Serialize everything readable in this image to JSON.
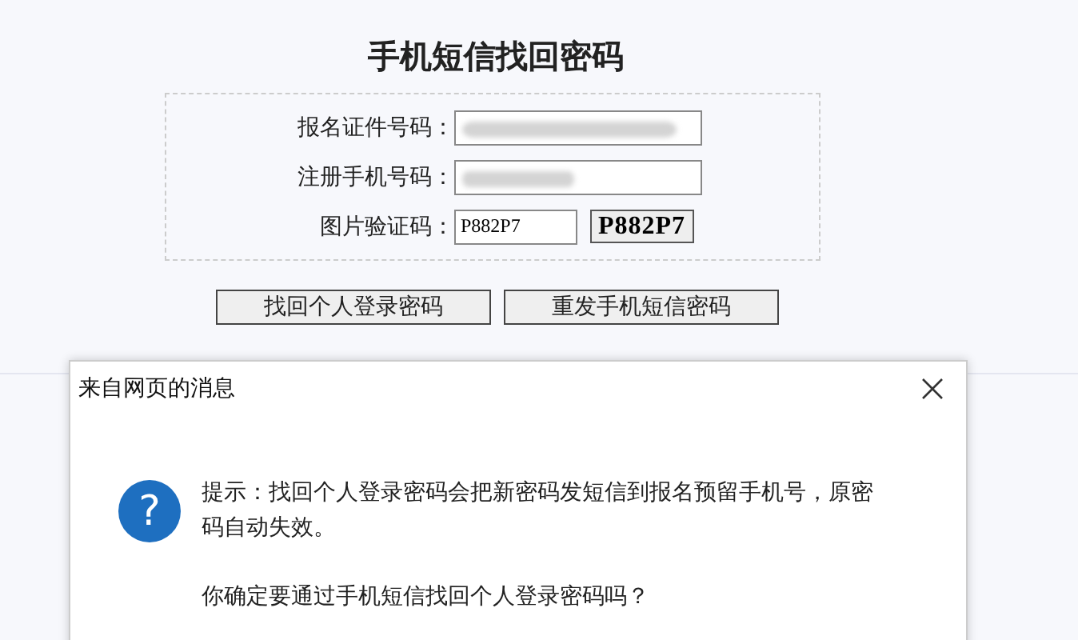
{
  "page": {
    "title": "手机短信找回密码"
  },
  "form": {
    "fields": [
      {
        "kind": "masked",
        "label": "报名证件号码："
      },
      {
        "kind": "masked",
        "label": "注册手机号码："
      },
      {
        "kind": "captcha",
        "label": "图片验证码：",
        "value": "P882P7",
        "captcha_text": "P882P7"
      }
    ]
  },
  "buttons": [
    "找回个人登录密码",
    "重发手机短信密码"
  ],
  "dialog": {
    "title": "来自网页的消息",
    "icon": "?",
    "message": "提示：找回个人登录密码会把新密码发短信到报名预留手机号，原密码自动失效。",
    "question": "你确定要通过手机短信找回个人登录密码吗？"
  }
}
